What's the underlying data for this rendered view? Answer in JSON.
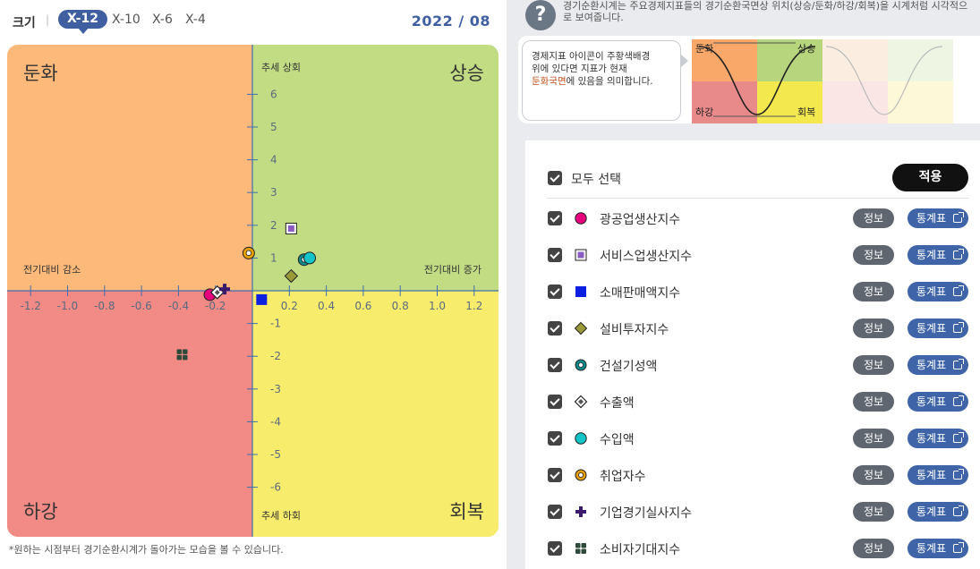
{
  "toolbar": {
    "size_label": "크기",
    "separator": "|",
    "zoom_options": [
      "X-12",
      "X-10",
      "X-6",
      "X-4"
    ],
    "active_zoom": "X-12",
    "date": "2022 / 08"
  },
  "quadrants": {
    "top_left": "둔화",
    "top_right": "상승",
    "bottom_left": "하강",
    "bottom_right": "회복"
  },
  "axis_labels": {
    "y_top": "추세 상회",
    "y_bottom": "추세 하회",
    "x_left": "전기대비 감소",
    "x_right": "전기대비 증가"
  },
  "chart_data": {
    "type": "scatter",
    "xlim": [
      -1.3,
      1.3
    ],
    "ylim": [
      -7.5,
      7.5
    ],
    "x_ticks": [
      "-1.2",
      "-1.0",
      "-0.8",
      "-0.6",
      "-0.4",
      "-0.2",
      "0.2",
      "0.4",
      "0.6",
      "0.8",
      "1.0",
      "1.2"
    ],
    "x_tick_values": [
      -1.2,
      -1.0,
      -0.8,
      -0.6,
      -0.4,
      -0.2,
      0.2,
      0.4,
      0.6,
      0.8,
      1.0,
      1.2
    ],
    "y_ticks": [
      "6",
      "5",
      "4",
      "3",
      "2",
      "1",
      "-1",
      "-2",
      "-3",
      "-4",
      "-5",
      "-6"
    ],
    "y_tick_values": [
      6,
      5,
      4,
      3,
      2,
      1,
      -1,
      -2,
      -3,
      -4,
      -5,
      -6
    ],
    "grid": false,
    "series": [
      {
        "name": "광공업생산지수",
        "marker": "circle",
        "color": "#e6007e",
        "x": -0.23,
        "y": -0.12
      },
      {
        "name": "서비스업생산지수",
        "marker": "square-outline",
        "color": "#8b5cc4",
        "x": 0.21,
        "y": 1.9
      },
      {
        "name": "소매판매액지수",
        "marker": "square",
        "color": "#0a1fe0",
        "x": 0.05,
        "y": -0.27
      },
      {
        "name": "설비투자지수",
        "marker": "diamond",
        "color": "#9a9a38",
        "x": 0.21,
        "y": 0.45
      },
      {
        "name": "건설기성액",
        "marker": "ring",
        "color": "#0f8a8a",
        "x": 0.28,
        "y": 0.95
      },
      {
        "name": "수출액",
        "marker": "diamond-outline",
        "color": "#555555",
        "x": -0.19,
        "y": -0.05
      },
      {
        "name": "수입액",
        "marker": "circle",
        "color": "#11c4c8",
        "x": 0.31,
        "y": 1.0
      },
      {
        "name": "취업자수",
        "marker": "ring",
        "color": "#e8a000",
        "x": -0.02,
        "y": 1.15
      },
      {
        "name": "기업경기실사지수",
        "marker": "cross",
        "color": "#3a1a6b",
        "x": -0.15,
        "y": 0.05
      },
      {
        "name": "소비자기대지수",
        "marker": "grid",
        "color": "#2e4a3a",
        "x": -0.38,
        "y": -1.95
      }
    ]
  },
  "footnote": "*원하는 시점부터 경기순환시계가 돌아가는 모습을 볼 수 있습니다.",
  "help": {
    "icon": "question-icon",
    "text": "경기순환시계는 주요경제지표들의 경기순환국면상 위치(상승/둔화/하강/회복)을 시계처럼 시각적으로 보여줍니다."
  },
  "legend_card": {
    "bubble_line1": "경제지표 아이콘이 주황색배경",
    "bubble_line2": "위에 있다면 지표가 현재",
    "bubble_highlight": "둔화국면",
    "bubble_tail": "에 있음을 의미합니다.",
    "cycle_labels": {
      "slowdown": "둔화",
      "rise": "상승",
      "decline": "하강",
      "recovery": "회복"
    }
  },
  "list": {
    "select_all_label": "모두 선택",
    "apply_label": "적용",
    "info_label": "정보",
    "stat_label": "통계표",
    "items": [
      {
        "label": "광공업생산지수"
      },
      {
        "label": "서비스업생산지수"
      },
      {
        "label": "소매판매액지수"
      },
      {
        "label": "설비투자지수"
      },
      {
        "label": "건설기성액"
      },
      {
        "label": "수출액"
      },
      {
        "label": "수입액"
      },
      {
        "label": "취업자수"
      },
      {
        "label": "기업경기실사지수"
      },
      {
        "label": "소비자기대지수"
      }
    ]
  }
}
